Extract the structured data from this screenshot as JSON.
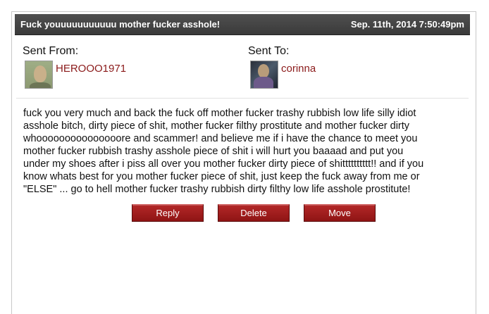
{
  "header": {
    "subject": "Fuck youuuuuuuuuuu mother fucker asshole!",
    "date": "Sep. 11th, 2014 7:50:49pm"
  },
  "sender": {
    "label": "Sent From:",
    "username": "HEROOO1971",
    "avatar_icon": "user-avatar"
  },
  "recipient": {
    "label": "Sent To:",
    "username": "corinna",
    "avatar_icon": "user-avatar"
  },
  "message": {
    "lines": [
      "fuck you very much and back the fuck off mother fucker trashy rubbish low life silly idiot",
      "asshole bitch, dirty piece of shit, mother fucker filthy prostitute and mother fucker dirty",
      "whooooooooooooooore and scammer! and believe me if i have the chance to meet you",
      "mother fucker rubbish trashy asshole piece of shit i will hurt you baaaad and put you",
      "under my shoes after i piss all over you mother fucker dirty piece of shitttttttttt!! and if you",
      "know whats best for you mother fucker piece of shit, just keep the fuck away from me or",
      "\"ELSE\" ... go to hell mother fucker trashy rubbish dirty filthy low life asshole prostitute!"
    ]
  },
  "actions": {
    "reply": "Reply",
    "delete": "Delete",
    "move": "Move"
  },
  "colors": {
    "titlebar": "#3a3a3a",
    "username": "#8b1a1a",
    "button": "#a01c1c"
  }
}
